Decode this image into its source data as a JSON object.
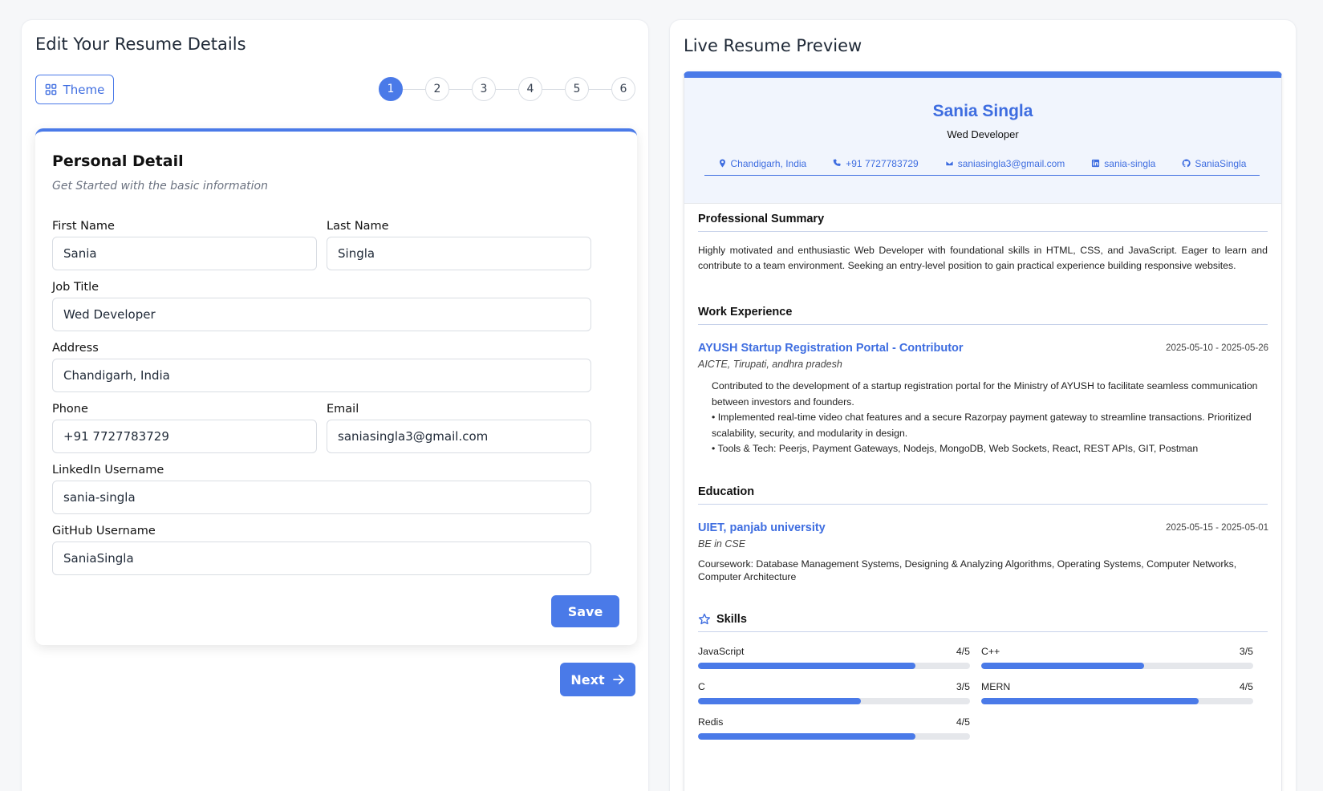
{
  "editor": {
    "title": "Edit Your Resume Details",
    "theme_label": "Theme",
    "steps": [
      "1",
      "2",
      "3",
      "4",
      "5",
      "6"
    ],
    "active_step": 1,
    "form": {
      "title": "Personal Detail",
      "subtitle": "Get Started with the basic information",
      "first_name_label": "First Name",
      "first_name": "Sania",
      "last_name_label": "Last Name",
      "last_name": "Singla",
      "job_title_label": "Job Title",
      "job_title": "Wed Developer",
      "address_label": "Address",
      "address": "Chandigarh, India",
      "phone_label": "Phone",
      "phone": "+91 7727783729",
      "email_label": "Email",
      "email": "saniasingla3@gmail.com",
      "linkedin_label": "LinkedIn Username",
      "linkedin": "sania-singla",
      "github_label": "GitHub Username",
      "github": "SaniaSingla",
      "save_label": "Save"
    },
    "next_label": "Next"
  },
  "preview": {
    "title": "Live Resume Preview",
    "accent_color": "#4a7ae8",
    "name": "Sania Singla",
    "job_title": "Wed Developer",
    "contacts": {
      "location": "Chandigarh, India",
      "phone": "+91 7727783729",
      "email": "saniasingla3@gmail.com",
      "linkedin": "sania-singla",
      "github": "SaniaSingla"
    },
    "summary_heading": "Professional Summary",
    "summary": "Highly motivated and enthusiastic Web Developer with foundational skills in HTML, CSS, and JavaScript. Eager to learn and contribute to a team environment. Seeking an entry-level position to gain practical experience building responsive websites.",
    "experience_heading": "Work Experience",
    "experience": {
      "title": "AYUSH Startup Registration Portal - Contributor",
      "dates": "2025-05-10 - 2025-05-26",
      "company": "AICTE, Tirupati, andhra pradesh",
      "lines": [
        "Contributed to the development of a startup registration portal for the Ministry of AYUSH to facilitate seamless communication between investors and founders.",
        "• Implemented real-time video chat features and a secure Razorpay payment gateway to streamline transactions. Prioritized scalability, security, and modularity in design.",
        "• Tools & Tech: Peerjs, Payment Gateways, Nodejs, MongoDB, Web Sockets, React, REST APIs, GIT, Postman"
      ]
    },
    "education_heading": "Education",
    "education": {
      "school": "UIET, panjab university",
      "dates": "2025-05-15 - 2025-05-01",
      "degree": "BE in CSE",
      "coursework": "Coursework: Database Management Systems, Designing & Analyzing Algorithms, Operating Systems, Computer Networks, Computer Architecture"
    },
    "skills_heading": "Skills",
    "skills": [
      {
        "name": "JavaScript",
        "rating_text": "4/5",
        "rating": 0.8
      },
      {
        "name": "C++",
        "rating_text": "3/5",
        "rating": 0.6
      },
      {
        "name": "C",
        "rating_text": "3/5",
        "rating": 0.6
      },
      {
        "name": "MERN",
        "rating_text": "4/5",
        "rating": 0.8
      },
      {
        "name": "Redis",
        "rating_text": "4/5",
        "rating": 0.8
      }
    ]
  }
}
